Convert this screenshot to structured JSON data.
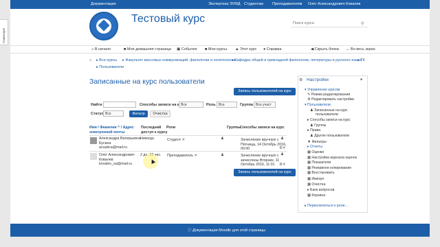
{
  "topbar": {
    "docs": "Документация",
    "links": [
      "Экспертиза ЭУМД",
      "Студентам",
      "Преподавателям",
      "Олег Александрович Ковалев"
    ]
  },
  "side_tab": "Навигация",
  "site": {
    "title": "Тестовый курс",
    "search_placeholder": "Поиск курса"
  },
  "nav": {
    "left": [
      "В начало",
      "Моя домашняя страница",
      "События",
      "Мои курсы",
      "Этот курс",
      "Справка"
    ],
    "right": [
      "Скрыть блоки",
      "Во весь экран"
    ]
  },
  "breadcrumb": [
    "Все курсы",
    "Факультет массовых коммуникаций, филологии и политологии",
    "Кафедра общей и прикладной филологии, литературы и русского языка",
    "ТК",
    "Пользователи"
  ],
  "heading": "Записанные на курс пользователи",
  "enrol_button": "Запись пользователей на курс",
  "filters": {
    "name_label": "Найти",
    "method_label": "Способы записи на курс",
    "method_value": "Все",
    "role_label": "Роль",
    "role_value": "Все",
    "group_label": "Группа",
    "group_value": "Все участ",
    "status_label": "Статус",
    "status_value": "Все",
    "filter_button": "Фильтр",
    "clear_button": "Очистка"
  },
  "table": {
    "col_name": [
      "Имя / Фамилия ^ / Адрес",
      "электронной почты"
    ],
    "col_access": [
      "Последний",
      "доступ к курсу"
    ],
    "col_role": "Роли",
    "col_groups": "Группы",
    "col_methods": "Способы записи на курс",
    "rows": [
      {
        "name": [
          "Александра Валерьевна",
          "Бусина"
        ],
        "email": "acuatica@mail.ru",
        "access": "Никогда",
        "role": "Студент",
        "method": [
          "Зачисление вручную с",
          "Пятница, 14 Октябрь 2016,",
          "00:00"
        ]
      },
      {
        "name": [
          "Олег Александрович",
          "Ковалев"
        ],
        "email": "kovalev_oa@mail.ru",
        "access": "2 дн. 22 час.",
        "role": "Преподаватель",
        "method": [
          "Зачисление вручную с",
          "зачислены Вторник, 11",
          "Октябрь 2016, 11:01"
        ]
      }
    ]
  },
  "settings": {
    "title": "Настройки",
    "items": [
      "Управление курсом",
      "Режим редактирования",
      "Редактировать настройки",
      "Пользователи",
      "Записанные на курс",
      "пользователи",
      "Способы записи на курс",
      "Группы",
      "Права",
      "Другие пользователи",
      "Фильтры",
      "Отчеты",
      "Оценки",
      "Настройка журнала оценок",
      "Показатели",
      "Резервное копирование",
      "Восстановить",
      "Импорт",
      "Очистка",
      "Банк вопросов",
      "Корзина",
      "Переключиться к роли..."
    ]
  },
  "footer": "Документация Moodle для этой страницы"
}
